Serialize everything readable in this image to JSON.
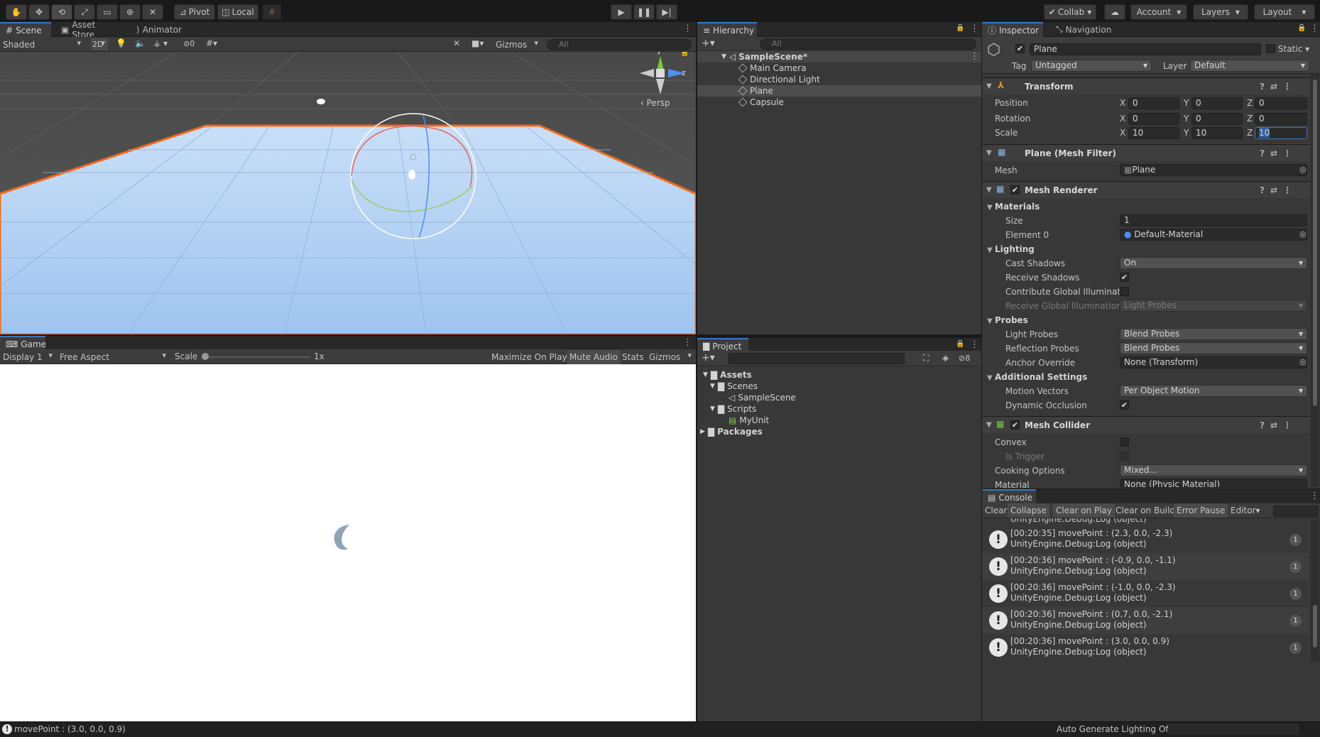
{
  "toolbar": {
    "pivot": "Pivot",
    "local": "Local",
    "collab": "Collab",
    "account": "Account",
    "layers": "Layers",
    "layout": "Layout"
  },
  "scene": {
    "tabs": [
      "Scene",
      "Asset Store",
      "Animator"
    ],
    "shading": "Shaded",
    "mode_2d": "2D",
    "hidden_count": "0",
    "gizmos": "Gizmos",
    "search_placeholder": "All",
    "persp": "Persp",
    "axis_y": "y",
    "axis_z": "z"
  },
  "game": {
    "tab": "Game",
    "display": "Display 1",
    "aspect": "Free Aspect",
    "scale_label": "Scale",
    "scale_value": "1x",
    "maximize": "Maximize On Play",
    "mute": "Mute Audio",
    "stats": "Stats",
    "gizmos": "Gizmos"
  },
  "hierarchy": {
    "tab": "Hierarchy",
    "search_placeholder": "All",
    "scene": "SampleScene*",
    "items": [
      "Main Camera",
      "Directional Light",
      "Plane",
      "Capsule"
    ]
  },
  "project": {
    "tab": "Project",
    "hidden_count": "8",
    "assets": "Assets",
    "scenes": "Scenes",
    "sample_scene": "SampleScene",
    "scripts": "Scripts",
    "my_unit": "MyUnit",
    "packages": "Packages"
  },
  "inspector": {
    "tabs": [
      "Inspector",
      "Navigation"
    ],
    "object_name": "Plane",
    "static": "Static",
    "tag_label": "Tag",
    "tag": "Untagged",
    "layer_label": "Layer",
    "layer": "Default",
    "transform": {
      "title": "Transform",
      "position_label": "Position",
      "rotation_label": "Rotation",
      "scale_label": "Scale",
      "axes": [
        "X",
        "Y",
        "Z"
      ],
      "position": [
        "0",
        "0",
        "0"
      ],
      "rotation": [
        "0",
        "0",
        "0"
      ],
      "scale": [
        "10",
        "10",
        "10"
      ]
    },
    "mesh_filter": {
      "title": "Plane (Mesh Filter)",
      "mesh_label": "Mesh",
      "mesh": "Plane"
    },
    "mesh_renderer": {
      "title": "Mesh Renderer",
      "materials": "Materials",
      "size_label": "Size",
      "size": "1",
      "element0_label": "Element 0",
      "element0": "Default-Material",
      "lighting": "Lighting",
      "cast_shadows_label": "Cast Shadows",
      "cast_shadows": "On",
      "receive_shadows_label": "Receive Shadows",
      "contribute_gi_label": "Contribute Global Illuminatio",
      "receive_gi_label": "Receive Global Illumination",
      "receive_gi": "Light Probes",
      "probes": "Probes",
      "light_probes_label": "Light Probes",
      "light_probes": "Blend Probes",
      "reflection_probes_label": "Reflection Probes",
      "reflection_probes": "Blend Probes",
      "anchor_override_label": "Anchor Override",
      "anchor_override": "None (Transform)",
      "additional": "Additional Settings",
      "motion_vectors_label": "Motion Vectors",
      "motion_vectors": "Per Object Motion",
      "dynamic_occlusion_label": "Dynamic Occlusion"
    },
    "mesh_collider": {
      "title": "Mesh Collider",
      "convex_label": "Convex",
      "is_trigger_label": "Is Trigger",
      "cooking_label": "Cooking Options",
      "cooking": "Mixed...",
      "material_label": "Material",
      "material": "None (Physic Material)"
    }
  },
  "console": {
    "tab": "Console",
    "buttons": [
      "Clear",
      "Collapse",
      "Clear on Play",
      "Clear on Build",
      "Error Pause",
      "Editor"
    ],
    "partial_line": "UnityEngine.Debug:Log (object)",
    "logs": [
      {
        "line1": "[00:20:35] movePoint : (2.3, 0.0, -2.3)",
        "line2": "UnityEngine.Debug:Log (object)",
        "count": "1"
      },
      {
        "line1": "[00:20:36] movePoint : (-0.9, 0.0, -1.1)",
        "line2": "UnityEngine.Debug:Log (object)",
        "count": "1"
      },
      {
        "line1": "[00:20:36] movePoint : (-1.0, 0.0, -2.3)",
        "line2": "UnityEngine.Debug:Log (object)",
        "count": "1"
      },
      {
        "line1": "[00:20:36] movePoint : (0.7, 0.0, -2.1)",
        "line2": "UnityEngine.Debug:Log (object)",
        "count": "1"
      },
      {
        "line1": "[00:20:36] movePoint : (3.0, 0.0, 0.9)",
        "line2": "UnityEngine.Debug:Log (object)",
        "count": "1"
      }
    ]
  },
  "status": {
    "message": "movePoint : (3.0, 0.0, 0.9)",
    "lighting": "Auto Generate Lighting Off"
  }
}
